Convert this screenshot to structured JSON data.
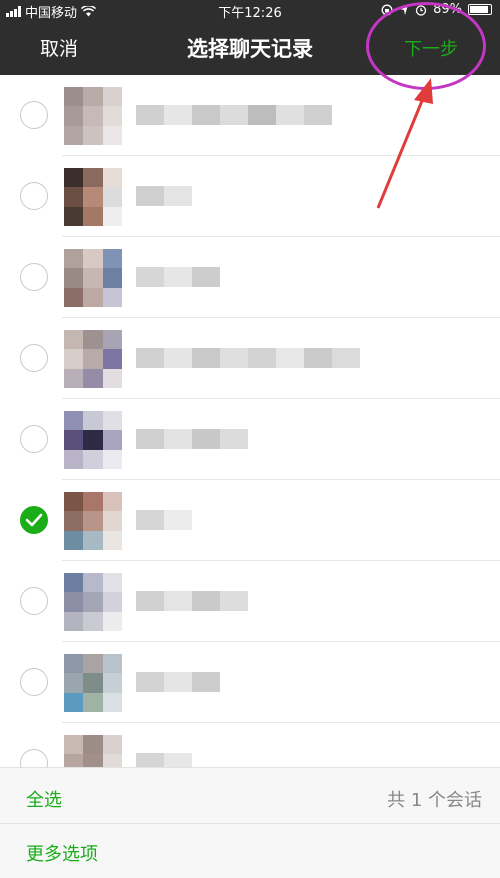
{
  "status": {
    "carrier": "中国移动",
    "time": "下午12:26",
    "battery": "89%"
  },
  "nav": {
    "cancel": "取消",
    "title": "选择聊天记录",
    "next": "下一步"
  },
  "colors": {
    "accent_green": "#1aad19",
    "annotation_magenta": "#c437c4",
    "annotation_arrow": "#e23b3b"
  },
  "chats": [
    {
      "checked": false,
      "avatar": [
        "#9a8f8c",
        "#b8aaa7",
        "#d8d1cf",
        "#a79a97",
        "#c5bab7",
        "#e1dcda",
        "#b2a6a3",
        "#ccc3c0",
        "#e9e6e5"
      ],
      "name": [
        "#d0d0d0",
        "#e6e6e6",
        "#c9c9c9",
        "#dcdcdc",
        "#bdbdbd",
        "#e0e0e0",
        "#cfcfcf"
      ]
    },
    {
      "checked": false,
      "avatar": [
        "#3a2f2b",
        "#8a6a5e",
        "#e5dcd8",
        "#6b4f44",
        "#b68a76",
        "#dcdcdc",
        "#4a3a34",
        "#a37865",
        "#eeeeee"
      ],
      "name": [
        "#cfcfcf",
        "#e4e4e4"
      ]
    },
    {
      "checked": false,
      "avatar": [
        "#b0a19c",
        "#d8c9c4",
        "#7f93b6",
        "#9a8a86",
        "#c7b7b2",
        "#6d7fa2",
        "#8b6e67",
        "#bda9a3",
        "#c9c3d6"
      ],
      "name": [
        "#d6d6d6",
        "#e6e6e6",
        "#cdcdcd"
      ]
    },
    {
      "checked": false,
      "avatar": [
        "#c4b6b1",
        "#9e9191",
        "#a9a4b4",
        "#d6ccc8",
        "#b7aba8",
        "#7d76a4",
        "#b9afb9",
        "#958ca6",
        "#e2dde0"
      ],
      "name": [
        "#d1d1d1",
        "#e5e5e5",
        "#c9c9c9",
        "#dedede",
        "#d3d3d3",
        "#e7e7e7",
        "#cbcbcb",
        "#dbdbdb"
      ]
    },
    {
      "checked": false,
      "avatar": [
        "#8e8fb2",
        "#c9c9d6",
        "#e0dfe6",
        "#5a4e7a",
        "#2f2a44",
        "#a9a3bf",
        "#b8b3c7",
        "#d1cfdb",
        "#eceaf0"
      ],
      "name": [
        "#cfcfcf",
        "#e3e3e3",
        "#c8c8c8",
        "#dcdcdc"
      ]
    },
    {
      "checked": true,
      "avatar": [
        "#7a5548",
        "#a9766a",
        "#d8c2bb",
        "#8d6d63",
        "#b99488",
        "#e1d6d2",
        "#6d8ea2",
        "#a7b9c3",
        "#e9e5e3"
      ],
      "name": [
        "#d6d6d6",
        "#ececec"
      ]
    },
    {
      "checked": false,
      "avatar": [
        "#6c7fa3",
        "#b5b9c9",
        "#e1e0e6",
        "#8c8fa6",
        "#a4a6b8",
        "#d3d2dc",
        "#b3b4c0",
        "#c9cad2",
        "#ececef"
      ],
      "name": [
        "#d1d1d1",
        "#e4e4e4",
        "#cacaca",
        "#dddddd"
      ]
    },
    {
      "checked": false,
      "avatar": [
        "#8e97a8",
        "#a9a3a3",
        "#b7c2cb",
        "#9aa6ad",
        "#7e8c8a",
        "#c6cfd3",
        "#5c9ac2",
        "#9fb3a7",
        "#d9dfe2"
      ],
      "name": [
        "#d3d3d3",
        "#e5e5e5",
        "#cccccc"
      ]
    },
    {
      "checked": false,
      "avatar": [
        "#c8b9b3",
        "#9e8c86",
        "#d9d1cf",
        "#b7a59f",
        "#a18f8a",
        "#e0dad8",
        "#c9bdb9",
        "#b3a6a2",
        "#ebe7e6"
      ],
      "name": [
        "#d5d5d5",
        "#e7e7e7"
      ]
    }
  ],
  "footer": {
    "select_all": "全选",
    "count": "共 1 个会话",
    "more_options": "更多选项"
  }
}
